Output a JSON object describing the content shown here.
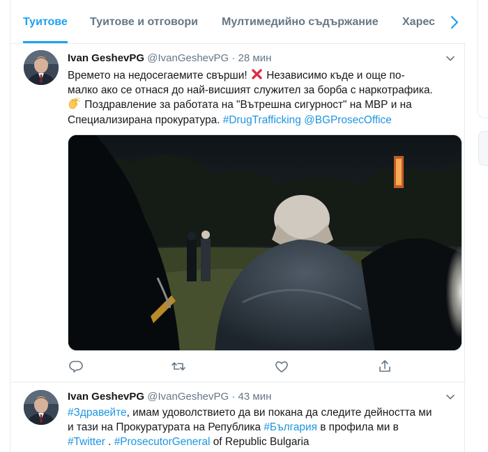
{
  "tabs": [
    {
      "label": "Туитове",
      "active": true
    },
    {
      "label": "Туитове и отговори",
      "active": false
    },
    {
      "label": "Мултимедийно съдържание",
      "active": false
    },
    {
      "label": "Харес",
      "active": false
    }
  ],
  "tweets": [
    {
      "fullname": "Ivan GeshevPG",
      "username": "@IvanGeshevPG",
      "separator": "·",
      "time": "28 мин",
      "lines": [
        {
          "text1": "Времето на недосегаемите свърши!",
          "text2": "Независимо къде и още по-"
        },
        {
          "text": "малко ако се отнася до най-висшият служител за борба с наркотрафика."
        },
        {
          "text": "Поздравление за работата на \"Вътрешна сигурност\" на МВР и на"
        },
        {
          "text": "Специализирана прокуратура.",
          "tag1": "#DrugTrafficking",
          "tag2": "@BGProsecOffice"
        }
      ]
    },
    {
      "fullname": "Ivan GeshevPG",
      "username": "@IvanGeshevPG",
      "separator": "·",
      "time": "43 мин",
      "lines": [
        {
          "tag": "#Здравейте",
          "text": ", имам удоволствието да ви покана да следите дейността ми"
        },
        {
          "text1": "и тази на Прокуратурата на Република",
          "tag": "#България",
          "text2": "в профила ми в"
        },
        {
          "tag1": "#Twitter",
          "text1": " .",
          "tag2": "#ProsecutorGeneral",
          "text2": "of Republic Bulgaria"
        }
      ]
    }
  ],
  "icons": {
    "caret": "chevron-down-icon",
    "reply": "reply-icon",
    "retweet": "retweet-icon",
    "like": "heart-icon",
    "share": "share-icon",
    "next": "chevron-right-icon"
  },
  "colors": {
    "accent": "#1da1f2",
    "link": "#1b95e0",
    "muted": "#657786",
    "text": "#14171a",
    "x_emoji": "#dd2e44"
  }
}
